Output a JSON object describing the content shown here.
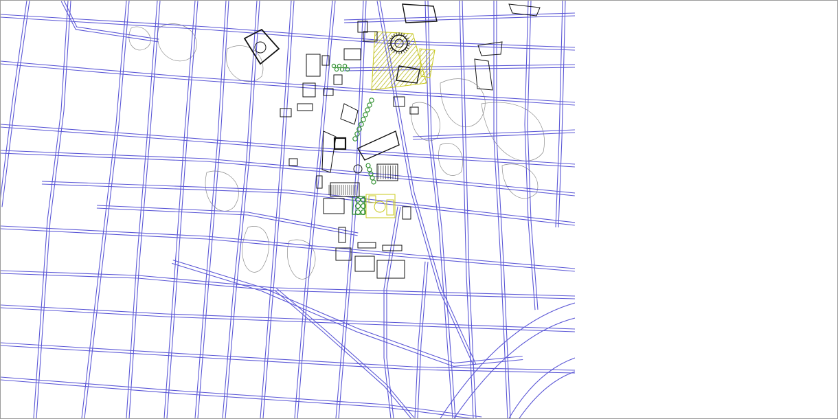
{
  "map": {
    "kind": "cad-street-plan",
    "colors": {
      "background": "#ffffff",
      "street": "#5b57d6",
      "building": "#111111",
      "vegetation": "#2f8f2f",
      "plaza": "#c8c81a",
      "terrain": "#8c8c8c",
      "frame": "#9a9a9a"
    }
  }
}
